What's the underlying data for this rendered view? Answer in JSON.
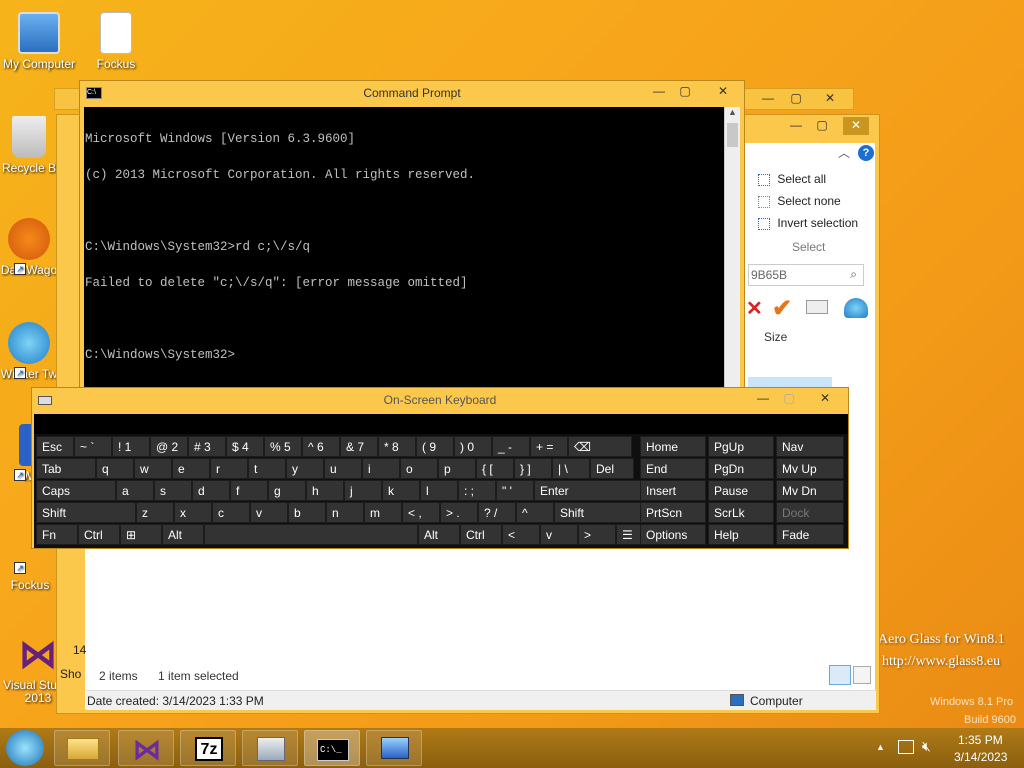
{
  "desktop": {
    "icons": [
      {
        "label": "My Computer"
      },
      {
        "label": "Fockus"
      },
      {
        "label": "Recycle B"
      },
      {
        "label": "DataWago"
      },
      {
        "label": "Winaer Tw"
      },
      {
        "label": "Wi"
      },
      {
        "label": "Fockus"
      },
      {
        "label": "Visual Studio 2013"
      }
    ],
    "watermark_line1": "Aero Glass for Win8.1",
    "watermark_line2": "http://www.glass8.eu",
    "os_line1": "Windows 8.1 Pro",
    "os_line2": "Build 9600"
  },
  "explorer": {
    "ribbon": {
      "select_all": "Select all",
      "select_none": "Select none",
      "invert_selection": "Invert selection",
      "group_label": "Select",
      "help": "?"
    },
    "search_value": "9B65B",
    "column_size": "Size",
    "left_cut_text": "Sho",
    "left_cut_num": "14",
    "status_items": "2 items",
    "status_selected": "1 item selected",
    "date_created": "Date created: 3/14/2023 1:33 PM",
    "computer_label": "Computer"
  },
  "cmd": {
    "title": "Command Prompt",
    "lines": [
      "Microsoft Windows [Version 6.3.9600]",
      "(c) 2013 Microsoft Corporation. All rights reserved.",
      "",
      "C:\\Windows\\System32>rd c;\\/s/q",
      "Failed to delete \"c;\\/s/q\": [error message omitted]",
      "",
      "C:\\Windows\\System32>"
    ]
  },
  "osk": {
    "title": "On-Screen Keyboard",
    "rows": [
      [
        {
          "k": "esc",
          "label": "Esc"
        },
        {
          "k": "tilde",
          "label": "~ `"
        },
        {
          "k": "1",
          "label": "! 1"
        },
        {
          "k": "2",
          "label": "@ 2"
        },
        {
          "k": "3",
          "label": "# 3"
        },
        {
          "k": "4",
          "label": "$ 4"
        },
        {
          "k": "5",
          "label": "% 5"
        },
        {
          "k": "6",
          "label": "^ 6"
        },
        {
          "k": "7",
          "label": "& 7"
        },
        {
          "k": "8",
          "label": "* 8"
        },
        {
          "k": "9",
          "label": "( 9"
        },
        {
          "k": "0",
          "label": ") 0"
        },
        {
          "k": "minus",
          "label": "_ -"
        },
        {
          "k": "equals",
          "label": "+ ="
        },
        {
          "k": "backspace",
          "label": "⌫"
        }
      ],
      [
        {
          "k": "tab",
          "label": "Tab"
        },
        {
          "k": "q",
          "label": "q"
        },
        {
          "k": "w",
          "label": "w"
        },
        {
          "k": "e",
          "label": "e"
        },
        {
          "k": "r",
          "label": "r"
        },
        {
          "k": "t",
          "label": "t"
        },
        {
          "k": "y",
          "label": "y"
        },
        {
          "k": "u",
          "label": "u"
        },
        {
          "k": "i",
          "label": "i"
        },
        {
          "k": "o",
          "label": "o"
        },
        {
          "k": "p",
          "label": "p"
        },
        {
          "k": "lbracket",
          "label": "{ ["
        },
        {
          "k": "rbracket",
          "label": "} ]"
        },
        {
          "k": "backslash",
          "label": "| \\"
        },
        {
          "k": "del",
          "label": "Del"
        }
      ],
      [
        {
          "k": "caps",
          "label": "Caps"
        },
        {
          "k": "a",
          "label": "a"
        },
        {
          "k": "s",
          "label": "s"
        },
        {
          "k": "d",
          "label": "d"
        },
        {
          "k": "f",
          "label": "f"
        },
        {
          "k": "g",
          "label": "g"
        },
        {
          "k": "h",
          "label": "h"
        },
        {
          "k": "j",
          "label": "j"
        },
        {
          "k": "k",
          "label": "k"
        },
        {
          "k": "l",
          "label": "l"
        },
        {
          "k": "semicolon",
          "label": ": ;"
        },
        {
          "k": "quote",
          "label": "\" '"
        },
        {
          "k": "enter",
          "label": "Enter"
        }
      ],
      [
        {
          "k": "shift-l",
          "label": "Shift"
        },
        {
          "k": "z",
          "label": "z"
        },
        {
          "k": "x",
          "label": "x"
        },
        {
          "k": "c",
          "label": "c"
        },
        {
          "k": "v",
          "label": "v"
        },
        {
          "k": "b",
          "label": "b"
        },
        {
          "k": "n",
          "label": "n"
        },
        {
          "k": "m",
          "label": "m"
        },
        {
          "k": "comma",
          "label": "< ,"
        },
        {
          "k": "period",
          "label": "> ."
        },
        {
          "k": "slash",
          "label": "? /"
        },
        {
          "k": "up",
          "label": "^"
        },
        {
          "k": "shift-r",
          "label": "Shift"
        }
      ],
      [
        {
          "k": "fn",
          "label": "Fn"
        },
        {
          "k": "ctrl-l",
          "label": "Ctrl"
        },
        {
          "k": "win",
          "label": "⊞"
        },
        {
          "k": "alt-l",
          "label": "Alt"
        },
        {
          "k": "space",
          "label": ""
        },
        {
          "k": "alt-r",
          "label": "Alt"
        },
        {
          "k": "ctrl-r",
          "label": "Ctrl"
        },
        {
          "k": "left",
          "label": "<"
        },
        {
          "k": "down",
          "label": "v"
        },
        {
          "k": "right",
          "label": ">"
        },
        {
          "k": "menu",
          "label": "☰"
        }
      ]
    ],
    "nav_keys": [
      [
        "Home",
        "PgUp",
        "Nav"
      ],
      [
        "End",
        "PgDn",
        "Mv Up"
      ],
      [
        "Insert",
        "Pause",
        "Mv Dn"
      ],
      [
        "PrtScn",
        "ScrLk",
        "Dock"
      ],
      [
        "Options",
        "Help",
        "Fade"
      ]
    ]
  },
  "taskbar": {
    "apps": [
      "ie-icon",
      "explorer-icon",
      "visual-studio-icon",
      "7zip-icon",
      "server-manager-icon",
      "cmd-icon",
      "remote-desktop-icon"
    ],
    "app_7z": "7z",
    "time": "1:35 PM",
    "date": "3/14/2023"
  }
}
